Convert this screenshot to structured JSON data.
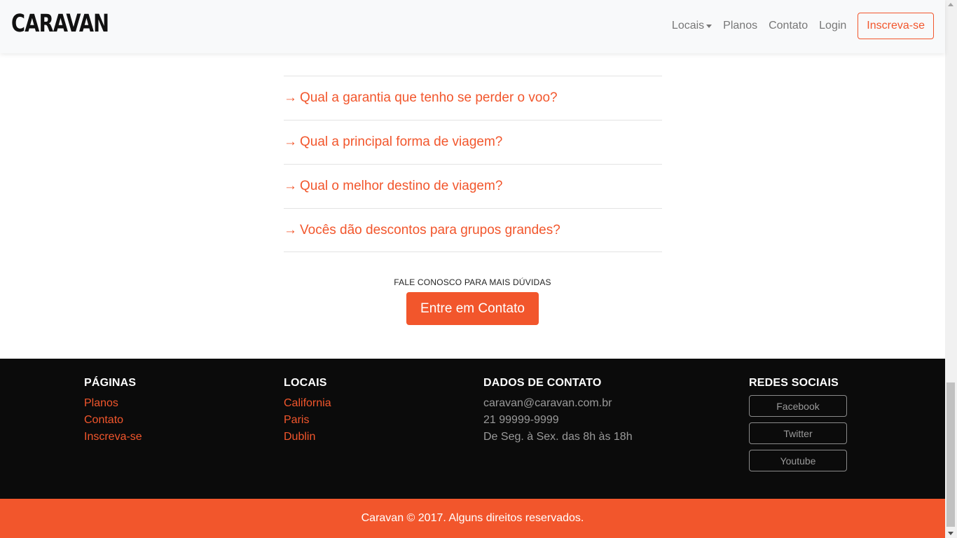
{
  "navbar": {
    "brand": "CARAVAN",
    "links": {
      "locais": "Locais",
      "planos": "Planos",
      "contato": "Contato",
      "login": "Login"
    },
    "signup": "Inscreva-se"
  },
  "faq": {
    "arrow": "→",
    "questions": [
      "Qual a garantia que tenho se perder o voo?",
      "Qual a principal forma de viagem?",
      "Qual o melhor destino de viagem?",
      "Vocês dão descontos para grupos grandes?"
    ]
  },
  "cta": {
    "label": "FALE CONOSCO PARA MAIS DÚVIDAS",
    "button": "Entre em Contato"
  },
  "footer": {
    "paginas": {
      "title": "PÁGINAS",
      "links": [
        "Planos",
        "Contato",
        "Inscreva-se"
      ]
    },
    "locais": {
      "title": "LOCAIS",
      "links": [
        "California",
        "Paris",
        "Dublin"
      ]
    },
    "contato": {
      "title": "DADOS DE CONTATO",
      "email": "caravan@caravan.com.br",
      "phone": "21 99999-9999",
      "hours": "De Seg. à Sex. das 8h às 18h"
    },
    "redes": {
      "title": "REDES SOCIAIS",
      "buttons": [
        "Facebook",
        "Twitter",
        "Youtube"
      ]
    }
  },
  "copyright": "Caravan © 2017. Alguns direitos reservados.",
  "colors": {
    "accent": "#f2562c",
    "footer_bg": "#0b0b0b",
    "navbar_bg": "#f8f9fa"
  }
}
